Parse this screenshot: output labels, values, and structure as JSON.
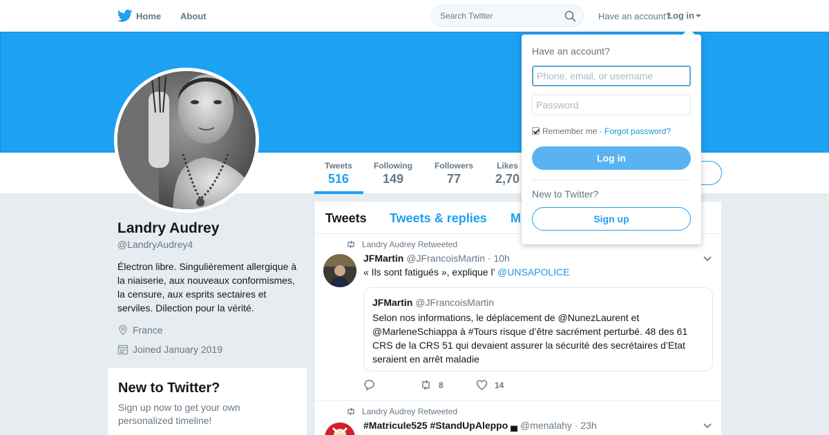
{
  "nav": {
    "home": "Home",
    "about": "About",
    "search_placeholder": "Search Twitter",
    "have_account": "Have an account?",
    "login": "Log in"
  },
  "stats": [
    {
      "label": "Tweets",
      "value": "516"
    },
    {
      "label": "Following",
      "value": "149"
    },
    {
      "label": "Followers",
      "value": "77"
    },
    {
      "label": "Likes",
      "value": "2,70"
    }
  ],
  "profile": {
    "name": "Landry Audrey",
    "handle": "@LandryAudrey4",
    "bio": "Électron libre. Singulièrement allergique à la niaiserie, aux nouveaux conformismes, la censure, aux esprits sectaires et serviles. Dilection pour la vérité.",
    "location": "France",
    "joined": "Joined January 2019"
  },
  "new_box": {
    "title": "New to Twitter?",
    "text": "Sign up now to get your own personalized timeline!"
  },
  "tabs": [
    "Tweets",
    "Tweets & replies",
    "M"
  ],
  "tweets": [
    {
      "retweeted_by": "Landry Audrey Retweeted",
      "name": "JFMartin",
      "handle": "@JFrancoisMartin · 10h",
      "text_prefix": "« Ils sont fatigués », explique l’ ",
      "text_link": "@UNSAPOLICE",
      "quote": {
        "name": "JFMartin",
        "handle": "@JFrancoisMartin",
        "text": "Selon nos informations, le déplacement de @NunezLaurent et @MarleneSchiappa à #Tours risque d’être sacrément perturbé. 48 des 61 CRS de la CRS 51 qui devaient assurer la sécurité des secrétaires d’Etat seraient en arrêt maladie"
      },
      "retweets": "8",
      "likes": "14"
    },
    {
      "retweeted_by": "Landry Audrey Retweeted",
      "name": "#Matricule525 #StandUpAleppo ▄",
      "handle": "@menalahy · 23h"
    }
  ],
  "dropdown": {
    "title": "Have an account?",
    "username_placeholder": "Phone, email, or username",
    "password_placeholder": "Password",
    "remember": "Remember me",
    "separator": " · ",
    "forgot": "Forgot password?",
    "login_button": "Log in",
    "new_to_twitter": "New to Twitter?",
    "signup_button": "Sign up"
  },
  "colors": {
    "brand": "#1da1f2",
    "link": "#1b95e0",
    "background": "#e6ecf0"
  }
}
